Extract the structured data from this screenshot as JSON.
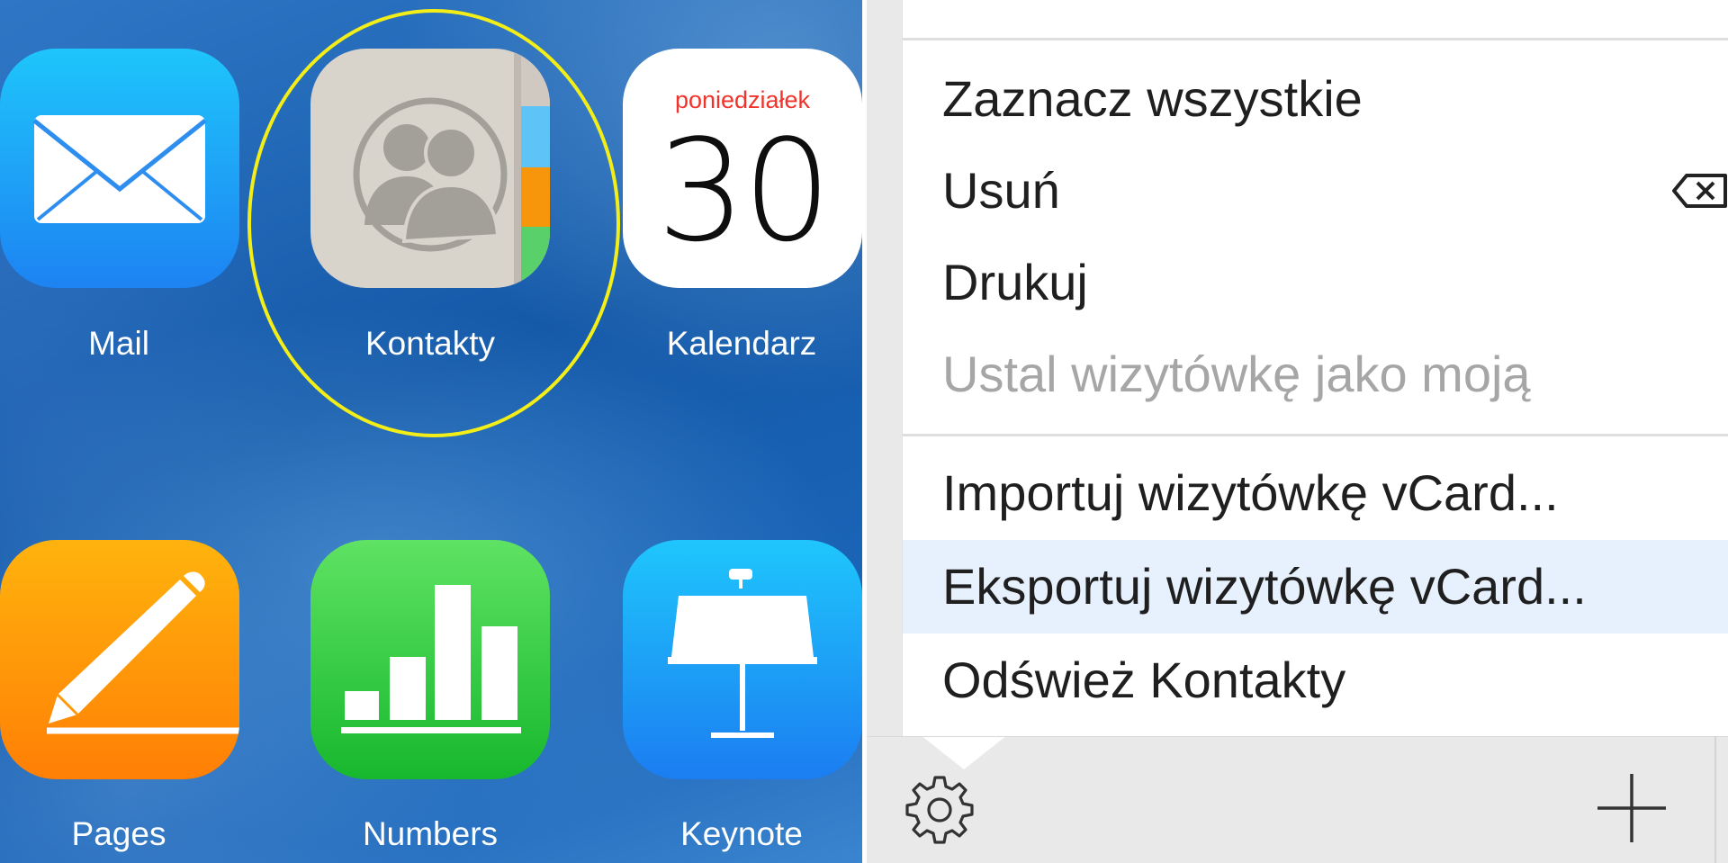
{
  "apps": {
    "mail": {
      "label": "Mail"
    },
    "contacts": {
      "label": "Kontakty"
    },
    "calendar": {
      "label": "Kalendarz",
      "weekday": "poniedziałek",
      "day": "30"
    },
    "pages": {
      "label": "Pages"
    },
    "numbers": {
      "label": "Numbers"
    },
    "keynote": {
      "label": "Keynote"
    }
  },
  "menu": {
    "items": [
      {
        "label": "Zaznacz wszystkie",
        "enabled": true
      },
      {
        "label": "Usuń",
        "enabled": true,
        "icon": "backspace-icon"
      },
      {
        "label": "Drukuj",
        "enabled": true
      },
      {
        "label": "Ustal wizytówkę jako moją",
        "enabled": false
      },
      {
        "label": "Importuj wizytówkę vCard...",
        "enabled": true
      },
      {
        "label": "Eksportuj wizytówkę vCard...",
        "enabled": true,
        "highlighted": true
      },
      {
        "label": "Odśwież Kontakty",
        "enabled": true
      }
    ]
  },
  "toolbar": {
    "settings_icon": "gear-icon",
    "add_icon": "plus-icon"
  },
  "colors": {
    "highlight_ring": "#f4ee18",
    "menu_highlight": "#e6f1fd",
    "disabled_text": "#a6a6a6",
    "calendar_weekday": "#f0332c"
  }
}
